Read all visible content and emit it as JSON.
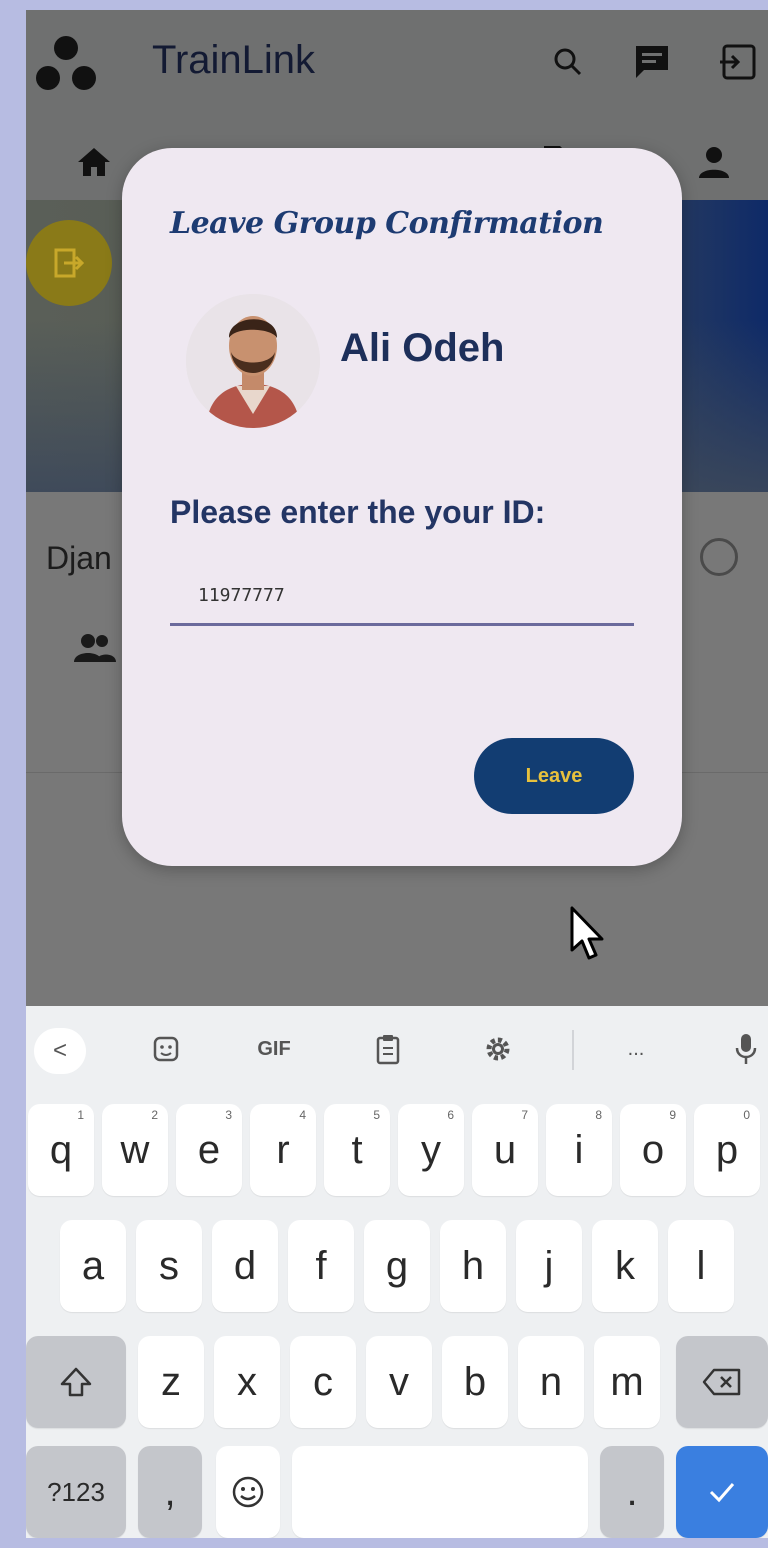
{
  "app": {
    "title": "TrainLink"
  },
  "page": {
    "group_name_partial": "Djan"
  },
  "dialog": {
    "title": "Leave Group Confirmation",
    "user_name": "Ali Odeh",
    "id_prompt": "Please enter the your ID:",
    "id_value": "11977777",
    "leave_label": "Leave"
  },
  "keyboard": {
    "toolbar": {
      "back": "<",
      "gif": "GIF",
      "more": "..."
    },
    "row1": [
      {
        "label": "q",
        "hint": "1"
      },
      {
        "label": "w",
        "hint": "2"
      },
      {
        "label": "e",
        "hint": "3"
      },
      {
        "label": "r",
        "hint": "4"
      },
      {
        "label": "t",
        "hint": "5"
      },
      {
        "label": "y",
        "hint": "6"
      },
      {
        "label": "u",
        "hint": "7"
      },
      {
        "label": "i",
        "hint": "8"
      },
      {
        "label": "o",
        "hint": "9"
      },
      {
        "label": "p",
        "hint": "0"
      }
    ],
    "row2": [
      "a",
      "s",
      "d",
      "f",
      "g",
      "h",
      "j",
      "k",
      "l"
    ],
    "row3": [
      "z",
      "x",
      "c",
      "v",
      "b",
      "n",
      "m"
    ],
    "bottom": {
      "symbols": "?123",
      "comma": ",",
      "period": "."
    }
  },
  "colors": {
    "dialog_bg": "#efe8f1",
    "title": "#1d3b72",
    "leave_button": "#123d72",
    "leave_text": "#e7c13d",
    "enter_key": "#3a7fe0"
  },
  "icons": [
    "logo-icon",
    "search-icon",
    "chat-icon",
    "logout-icon",
    "home-icon",
    "document-icon",
    "profile-icon",
    "exit-icon",
    "members-icon",
    "back-icon",
    "sticker-icon",
    "clipboard-icon",
    "settings-icon",
    "mic-icon",
    "shift-icon",
    "backspace-icon",
    "emoji-icon",
    "enter-check-icon",
    "mouse-cursor-icon"
  ]
}
